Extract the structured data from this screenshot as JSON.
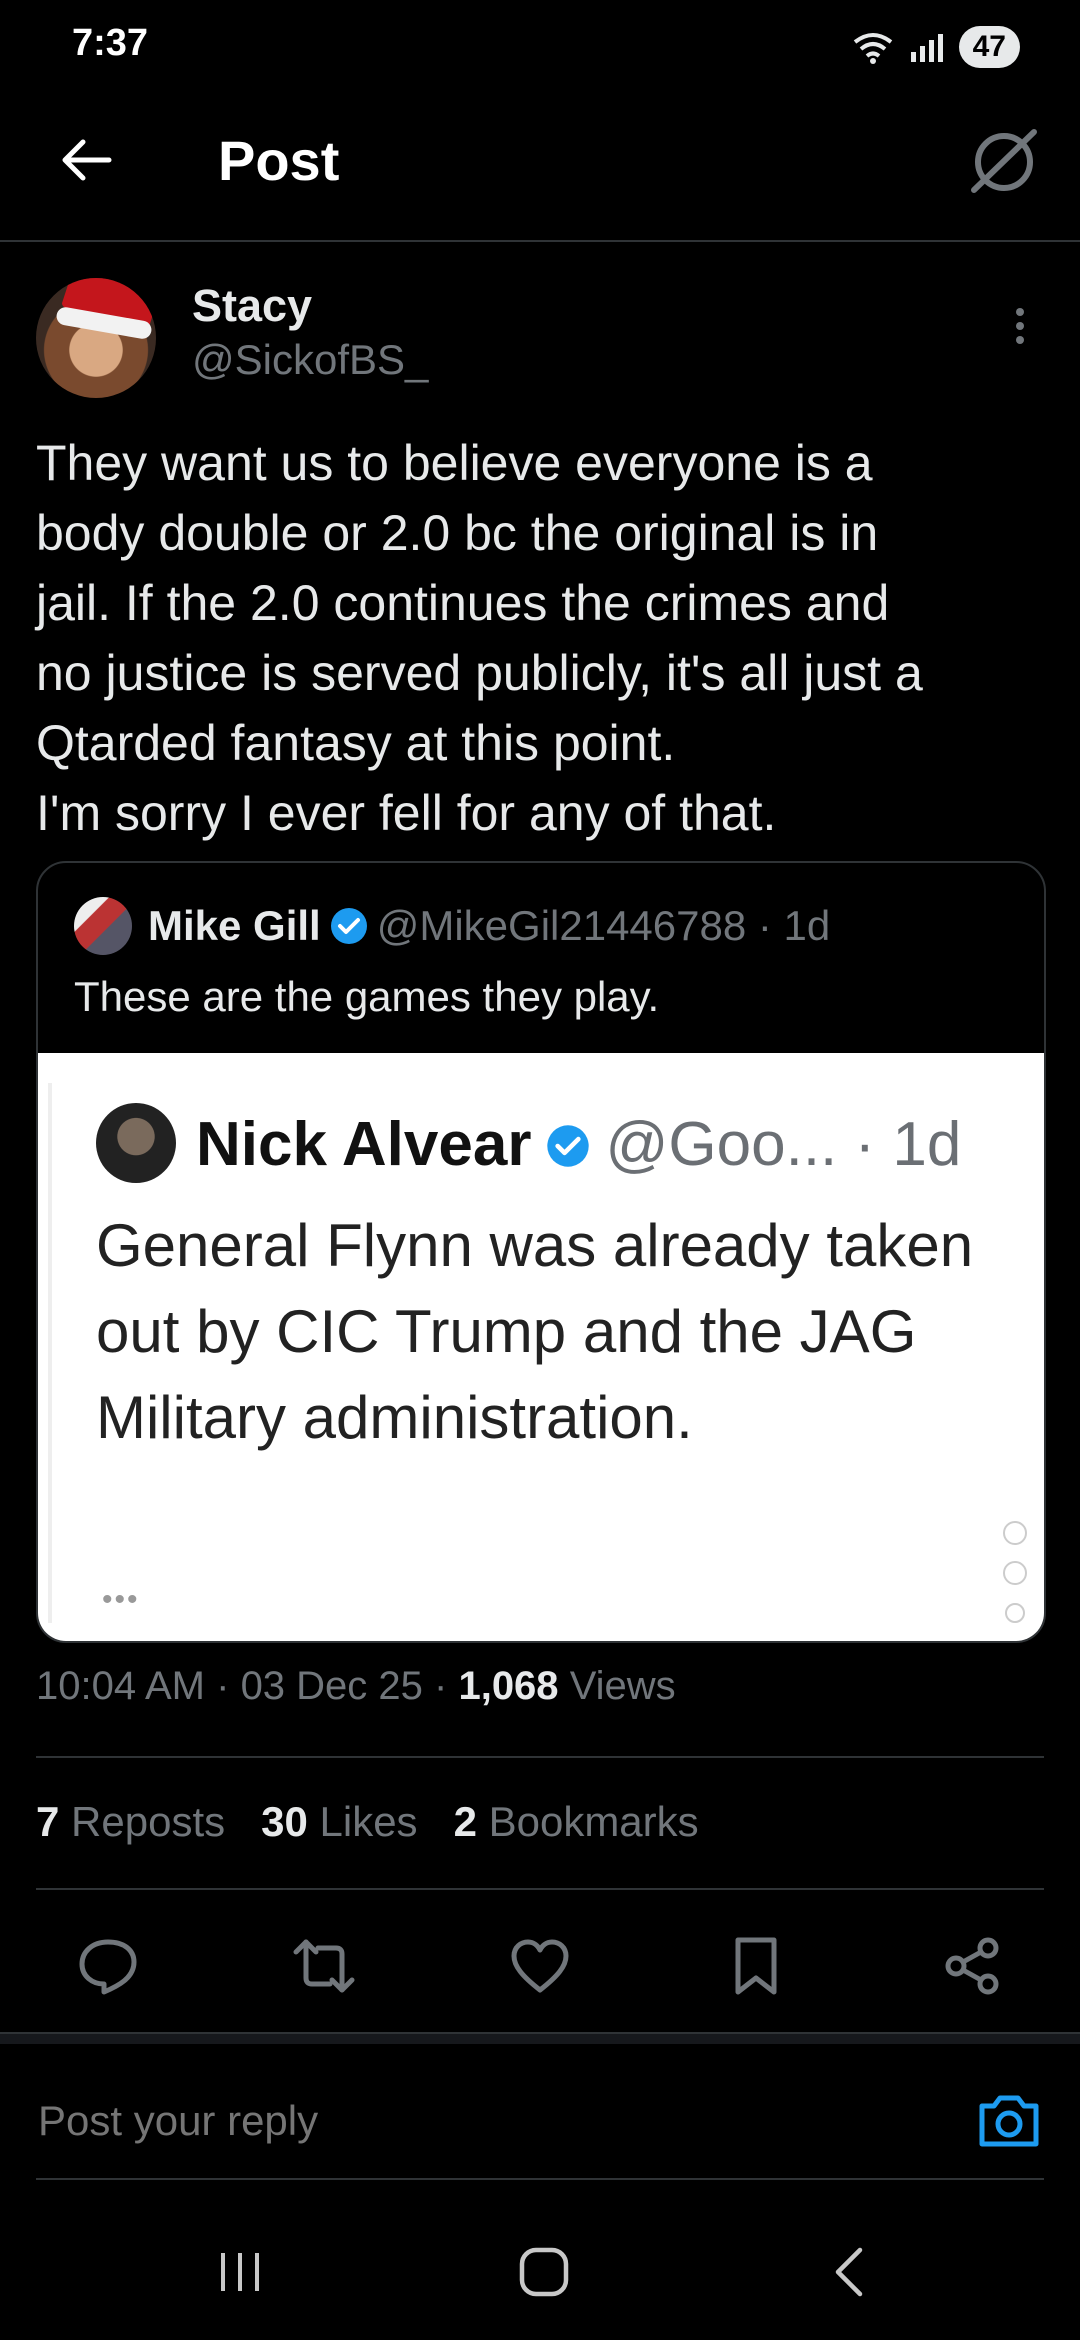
{
  "status_bar": {
    "time": "7:37",
    "battery": "47"
  },
  "header": {
    "title": "Post"
  },
  "author": {
    "name": "Stacy",
    "handle": "@SickofBS_"
  },
  "tweet": {
    "text": "They want us to believe everyone is a\nbody double or 2.0 bc the original is in\njail. If the 2.0 continues the crimes and\nno justice is served publicly, it's all just a\nQtarded fantasy at this point.\nI'm sorry I ever fell for any of that."
  },
  "quote": {
    "name": "Mike Gill",
    "handle": "@MikeGil21446788",
    "time": "· 1d",
    "text": "These are the games they play.",
    "embedded": {
      "name": "Nick Alvear",
      "handle": "@Goo...",
      "time": "· 1d",
      "text": "General Flynn was already taken out by CIC Trump and the JAG Military administration.",
      "dots": "•••"
    }
  },
  "meta": {
    "time": "10:04 AM",
    "date": "03 Dec 25",
    "views_count": "1,068",
    "views_label": "Views",
    "sep": " · "
  },
  "stats": {
    "reposts_count": "7",
    "reposts_label": "Reposts",
    "likes_count": "30",
    "likes_label": "Likes",
    "bookmarks_count": "2",
    "bookmarks_label": "Bookmarks"
  },
  "actions": [
    "reply-icon",
    "repost-icon",
    "like-icon",
    "bookmark-icon",
    "share-icon"
  ],
  "reply": {
    "placeholder": "Post your reply"
  },
  "colors": {
    "background": "#000000",
    "text": "#e7e9ea",
    "muted": "#71767b",
    "accent": "#1d9bf0",
    "divider": "#2f3336"
  }
}
